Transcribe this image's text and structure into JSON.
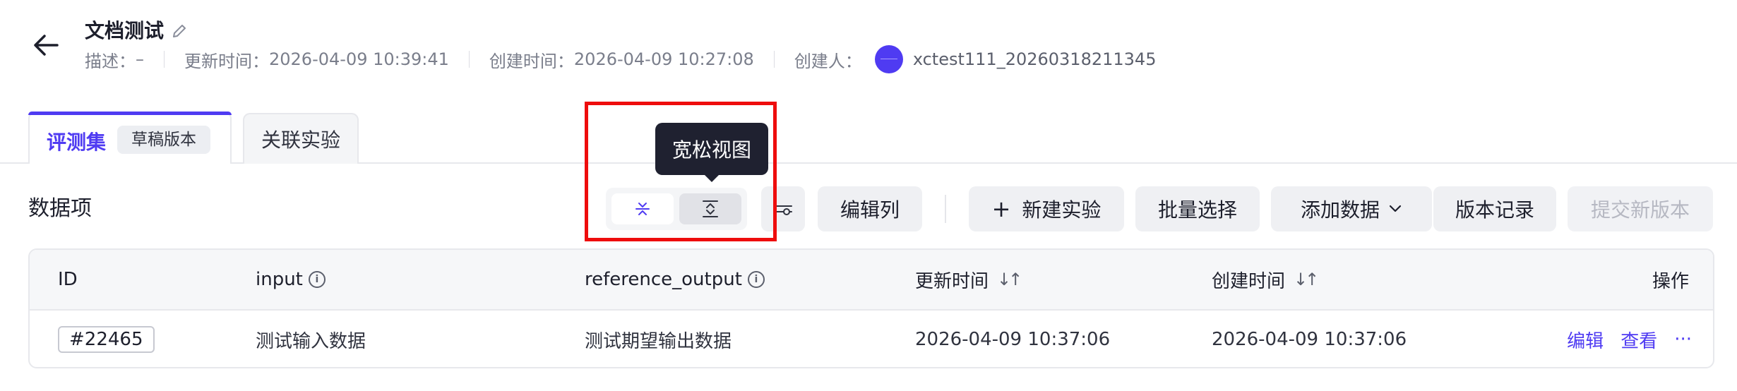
{
  "header": {
    "title": "文档测试",
    "description_label": "描述：",
    "description_value": "–",
    "updated_label": "更新时间：",
    "updated_value": "2026-04-09 10:39:41",
    "created_label": "创建时间：",
    "created_value": "2026-04-09 10:27:08",
    "creator_label": "创建人：",
    "creator_value": "xctest111_20260318211345"
  },
  "tabs": [
    {
      "label": "评测集",
      "badge": "草稿版本",
      "active": true
    },
    {
      "label": "关联实验",
      "active": false
    }
  ],
  "toolbar": {
    "section_title": "数据项",
    "density_options": [
      "compact",
      "loose"
    ],
    "selected_density": "loose",
    "tooltip": "宽松视图",
    "buttons": {
      "edit_columns": "编辑列",
      "new_experiment": "新建实验",
      "batch_select": "批量选择",
      "add_data": "添加数据",
      "version_history": "版本记录",
      "submit_version": "提交新版本"
    }
  },
  "table": {
    "columns": [
      "ID",
      "input",
      "reference_output",
      "更新时间",
      "创建时间",
      "操作"
    ],
    "rows": [
      {
        "id": "#22465",
        "input": "测试输入数据",
        "reference_output": "测试期望输出数据",
        "updated": "2026-04-09 10:37:06",
        "created": "2026-04-09 10:37:06",
        "actions": [
          "编辑",
          "查看",
          "···"
        ]
      }
    ]
  },
  "colors": {
    "accent": "#4f3bf2",
    "highlight": "#ee0d0d",
    "tooltip_bg": "#1f2130"
  }
}
